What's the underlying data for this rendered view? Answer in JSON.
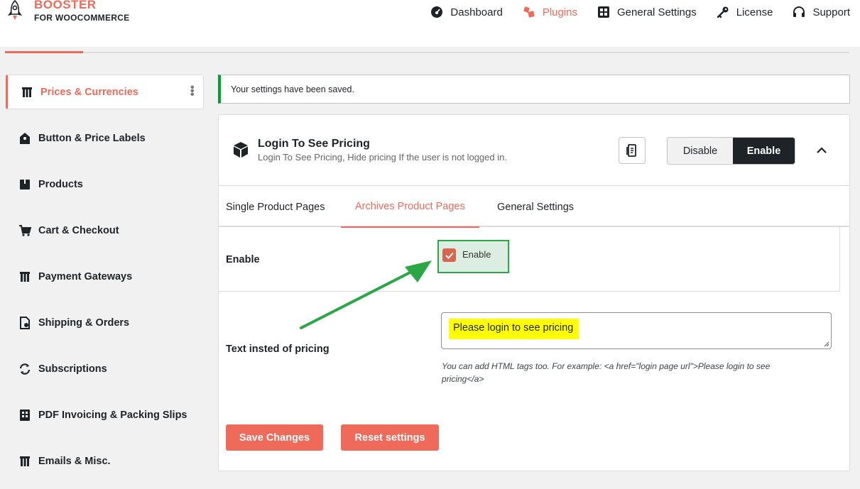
{
  "brand": {
    "line1": "BOOSTER",
    "line2": "FOR WOOCOMMERCE"
  },
  "nav": [
    {
      "label": "Dashboard",
      "icon": "dashboard-icon"
    },
    {
      "label": "Plugins",
      "icon": "plugins-icon",
      "active": true
    },
    {
      "label": "General Settings",
      "icon": "settings-icon"
    },
    {
      "label": "License",
      "icon": "key-icon"
    },
    {
      "label": "Support",
      "icon": "headset-icon"
    }
  ],
  "sidebar": {
    "items": [
      {
        "label": "Prices & Currencies",
        "icon": "prices-icon",
        "active": true
      },
      {
        "label": "Button & Price Labels",
        "icon": "label-icon"
      },
      {
        "label": "Products",
        "icon": "products-icon"
      },
      {
        "label": "Cart & Checkout",
        "icon": "cart-icon"
      },
      {
        "label": "Payment Gateways",
        "icon": "payment-icon"
      },
      {
        "label": "Shipping & Orders",
        "icon": "shipping-icon"
      },
      {
        "label": "Subscriptions",
        "icon": "subscriptions-icon"
      },
      {
        "label": "PDF Invoicing & Packing Slips",
        "icon": "pdf-icon"
      },
      {
        "label": "Emails & Misc.",
        "icon": "emails-icon"
      }
    ]
  },
  "notice": {
    "text": "Your settings have been saved."
  },
  "module": {
    "title": "Login To See Pricing",
    "description": "Login To See Pricing, Hide pricing If the user is not logged in.",
    "disable_label": "Disable",
    "enable_label": "Enable"
  },
  "tabs": [
    {
      "label": "Single Product Pages"
    },
    {
      "label": "Archives Product Pages",
      "active": true
    },
    {
      "label": "General Settings"
    }
  ],
  "fields": {
    "enable": {
      "label": "Enable",
      "checkbox_label": "Enable",
      "checked": true
    },
    "text": {
      "label": "Text insted of pricing",
      "value": "Please login to see pricing",
      "hint": "You can add HTML tags too. For example: <a href=\"login page url\">Please login to see pricing</a>"
    }
  },
  "actions": {
    "save_label": "Save Changes",
    "reset_label": "Reset settings"
  },
  "colors": {
    "accent": "#f06a5a",
    "dark": "#1d2327",
    "success": "#00a32a",
    "highlight": "#ffff00"
  }
}
